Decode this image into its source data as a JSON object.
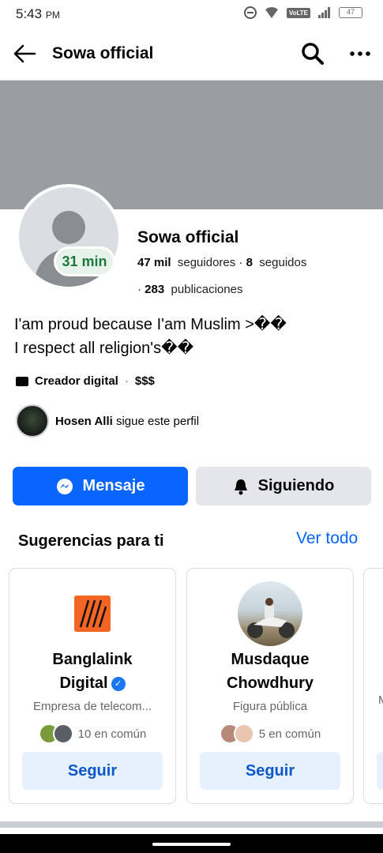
{
  "status_bar": {
    "time": "5:43",
    "ampm": "PM",
    "network": "VoLTE",
    "battery": "47"
  },
  "header": {
    "title": "Sowa official"
  },
  "profile": {
    "name": "Sowa official",
    "badge": "31 min",
    "followers_count": "47 mil",
    "followers_label": "seguidores",
    "following_count": "8",
    "following_label": "seguidos",
    "posts_count": "283",
    "posts_label": "publicaciones",
    "bio_line1": "I'am proud because  I'am Muslim >��",
    "bio_line2": "I respect all religion's��",
    "category": "Creador digital",
    "price": "$$$",
    "mutual_follower": "Hosen Alli",
    "mutual_text": "sigue este perfil"
  },
  "actions": {
    "message": "Mensaje",
    "following": "Siguiendo"
  },
  "suggestions": {
    "title": "Sugerencias para ti",
    "see_all": "Ver todo",
    "cards": [
      {
        "name_line1": "Banglalink",
        "name_line2": "Digital",
        "subtitle": "Empresa de telecom...",
        "common": "10 en común",
        "button": "Seguir",
        "verified": true
      },
      {
        "name_line1": "Musdaque",
        "name_line2": "Chowdhury",
        "subtitle": "Figura pública",
        "common": "5 en común",
        "button": "Seguir",
        "verified": false
      },
      {
        "subtitle": "M"
      }
    ]
  },
  "colors": {
    "accent": "#0866ff",
    "cover": "#9a9ea3",
    "badge_text": "#1b7a3a"
  },
  "icons": [
    "back-arrow-icon",
    "search-icon",
    "more-icon",
    "messenger-icon",
    "bell-icon",
    "category-icon",
    "verified-icon"
  ]
}
